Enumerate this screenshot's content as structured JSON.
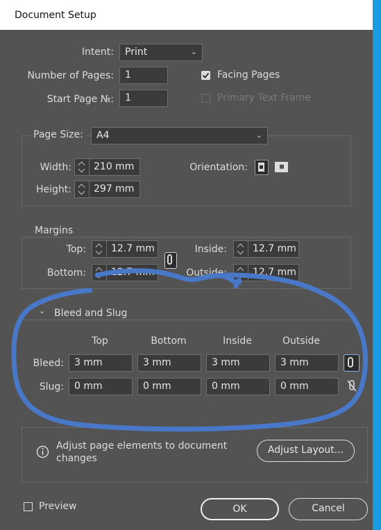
{
  "window": {
    "title": "Document Setup"
  },
  "general": {
    "intent_label": "Intent:",
    "intent_value": "Print",
    "pages_label": "Number of Pages:",
    "pages_value": "1",
    "facing_label": "Facing Pages",
    "facing_checked": true,
    "start_label": "Start Page №:",
    "start_value": "1",
    "primary_label": "Primary Text Frame",
    "primary_checked": false
  },
  "page_size": {
    "label": "Page Size:",
    "value": "A4",
    "width_label": "Width:",
    "width_value": "210 mm",
    "height_label": "Height:",
    "height_value": "297 mm",
    "orientation_label": "Orientation:"
  },
  "margins": {
    "title": "Margins",
    "top_label": "Top:",
    "top_value": "12.7 mm",
    "bottom_label": "Bottom:",
    "bottom_value": "12.7 mm",
    "inside_label": "Inside:",
    "inside_value": "12.7 mm",
    "outside_label": "Outside:",
    "outside_value": "12.7 mm"
  },
  "bleed_slug": {
    "title": "Bleed and Slug",
    "headers": [
      "Top",
      "Bottom",
      "Inside",
      "Outside"
    ],
    "bleed_label": "Bleed:",
    "bleed_values": [
      "3 mm",
      "3 mm",
      "3 mm",
      "3 mm"
    ],
    "slug_label": "Slug:",
    "slug_values": [
      "0 mm",
      "0 mm",
      "0 mm",
      "0 mm"
    ]
  },
  "info": {
    "text_line1": "Adjust page elements to document",
    "text_line2": "changes",
    "adjust_button": "Adjust Layout..."
  },
  "footer": {
    "preview_label": "Preview",
    "ok_label": "OK",
    "cancel_label": "Cancel"
  },
  "colors": {
    "dialog_bg": "#535353",
    "annotation_stroke": "#4a78c8",
    "window_frame": "#1a9ae0"
  }
}
